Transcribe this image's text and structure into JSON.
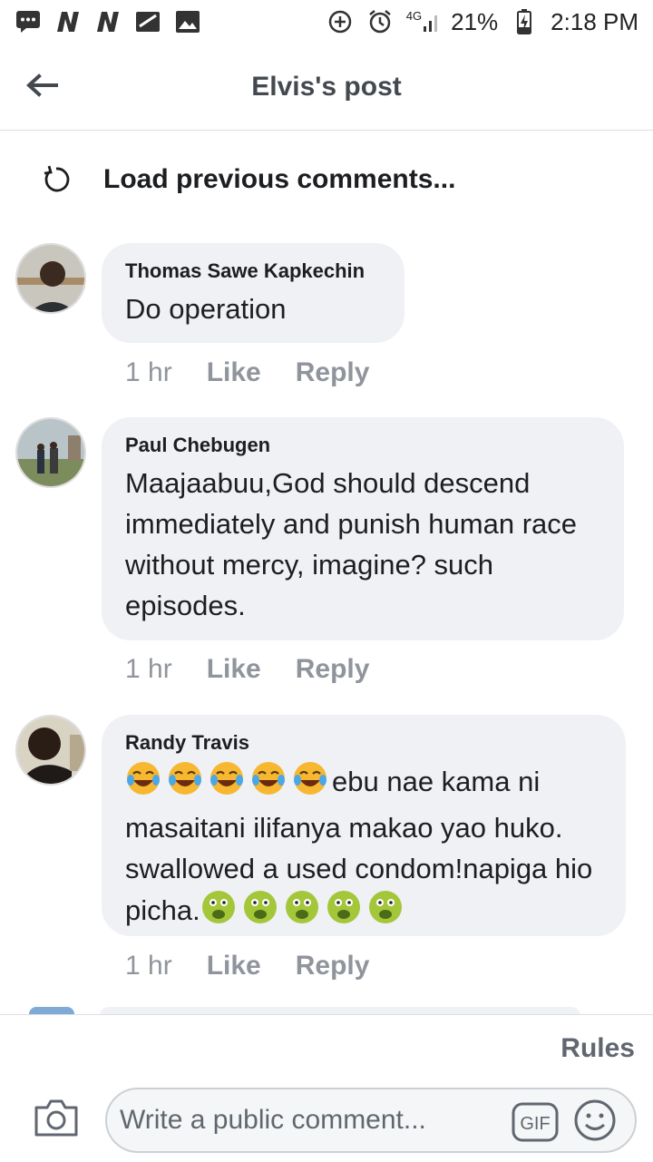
{
  "status_bar": {
    "network": "4G",
    "battery": "21%",
    "time": "2:18 PM"
  },
  "header": {
    "title": "Elvis's post"
  },
  "load_previous": "Load previous comments...",
  "comments": [
    {
      "author": "Thomas Sawe Kapkechin",
      "text": "Do operation",
      "time": "1 hr",
      "like": "Like",
      "reply": "Reply"
    },
    {
      "author": "Paul Chebugen",
      "text": "Maajaabuu,God should descend immediately and punish human race without mercy, imagine? such episodes.",
      "time": "1 hr",
      "like": "Like",
      "reply": "Reply"
    },
    {
      "author": "Randy Travis",
      "text_line1": "ebu nae kama ni",
      "text_rest": "masaitani ilifanya makao yao huko. swallowed a used condom!napiga hio picha.",
      "time": "1 hr",
      "like": "Like",
      "reply": "Reply"
    }
  ],
  "bottom": {
    "rules": "Rules",
    "placeholder": "Write a public comment...",
    "gif": "GIF"
  },
  "colors": {
    "bubble": "#eff1f4",
    "secondary_text": "#90949c",
    "laugh_emoji": "#f7b731",
    "sick_emoji": "#a4c639"
  }
}
